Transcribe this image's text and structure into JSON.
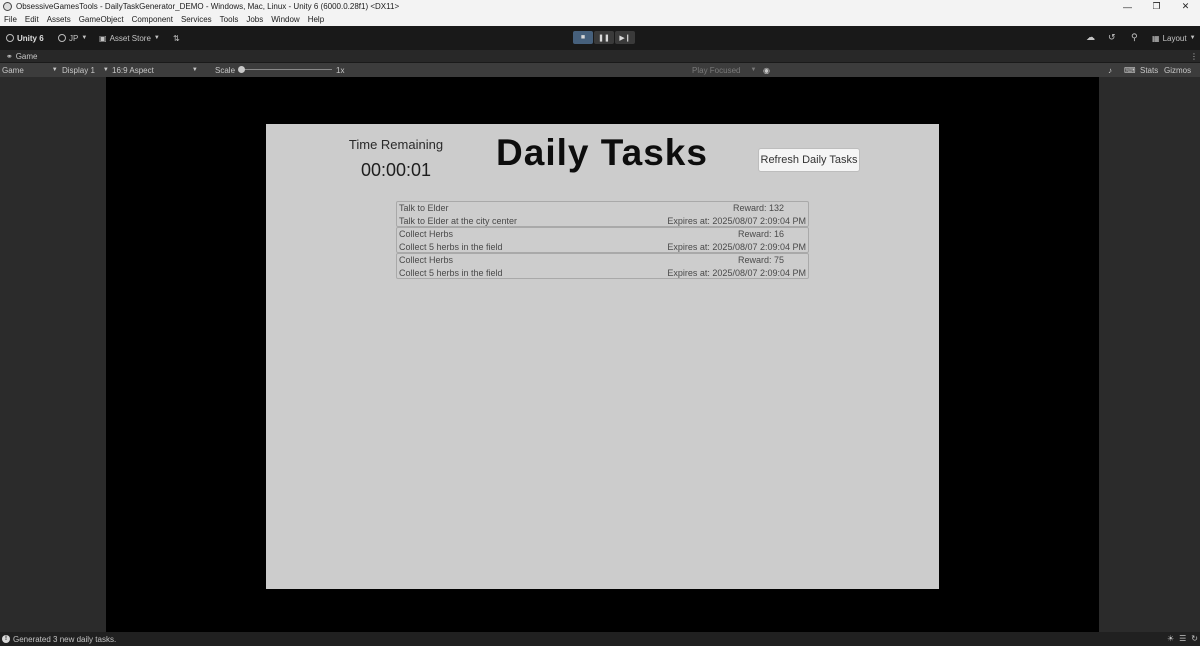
{
  "window": {
    "title": "ObsessiveGamesTools - DailyTaskGenerator_DEMO - Windows, Mac, Linux - Unity 6 (6000.0.28f1) <DX11>"
  },
  "menu": [
    "File",
    "Edit",
    "Assets",
    "GameObject",
    "Component",
    "Services",
    "Tools",
    "Jobs",
    "Window",
    "Help"
  ],
  "toolbar": {
    "unity_label": "Unity 6",
    "account_label": "JP",
    "asset_store_label": "Asset Store",
    "layout_label": "Layout"
  },
  "game_tab": {
    "label": "Game"
  },
  "game_bar": {
    "view_label": "Game",
    "display_label": "Display 1",
    "aspect_label": "16:9 Aspect",
    "scale_label": "Scale",
    "scale_value": "1x",
    "play_focused_label": "Play Focused",
    "stats_label": "Stats",
    "gizmos_label": "Gizmos"
  },
  "game": {
    "time_remaining_label": "Time Remaining",
    "time_remaining_value": "00:00:01",
    "heading": "Daily Tasks",
    "refresh_button": "Refresh Daily Tasks",
    "tasks": [
      {
        "title": "Talk to Elder",
        "reward": "Reward: 132",
        "description": "Talk to Elder at the city center",
        "expires": "Expires at: 2025/08/07 2:09:04 PM"
      },
      {
        "title": "Collect Herbs",
        "reward": "Reward: 16",
        "description": "Collect 5 herbs in the field",
        "expires": "Expires at: 2025/08/07 2:09:04 PM"
      },
      {
        "title": "Collect Herbs",
        "reward": "Reward: 75",
        "description": "Collect 5 herbs in the field",
        "expires": "Expires at: 2025/08/07 2:09:04 PM"
      }
    ]
  },
  "status": {
    "message": "Generated 3 new daily tasks."
  },
  "colors": {
    "canvas": "#cccccc",
    "editor_bg": "#191919",
    "play_active": "#46607c"
  }
}
